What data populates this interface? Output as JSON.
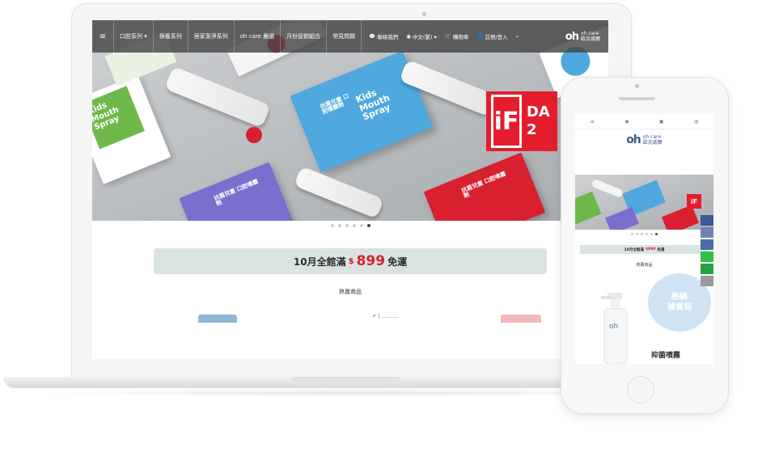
{
  "laptop": {
    "nav": {
      "menu_items": [
        {
          "label": "口腔系列 ▾"
        },
        {
          "label": "保養系列"
        },
        {
          "label": "居家潔淨系列"
        },
        {
          "label": "oh care 嚴選"
        },
        {
          "label": "月份促銷組合"
        },
        {
          "label": "常見問題"
        }
      ],
      "utilities": [
        {
          "icon": "chat-icon",
          "label": "聯絡我們"
        },
        {
          "icon": "globe-icon",
          "label": "中文(繁) ▾"
        },
        {
          "icon": "cart-icon",
          "label": "購物車"
        },
        {
          "icon": "user-icon",
          "label": "註冊/登入"
        },
        {
          "icon": "search-icon",
          "label": ""
        }
      ],
      "logo": {
        "mark": "oh",
        "line1": "oh care",
        "line2": "歐克威爾"
      }
    },
    "hero": {
      "box_texts": {
        "green_box": "Kids Mouth Spray",
        "blue_box": "Kids Mouth Spray",
        "pink_box": "Kids Mouth Spray",
        "purple_box": "抗菌兒童 口腔噴霧劑",
        "red_box": "抗菌兒童 口腔噴霧劑",
        "blue_box_cn": "抗菌兒童 口腔噴霧劑"
      },
      "award": {
        "main": "iF",
        "side": "DA 2"
      },
      "slides_count": 6,
      "active_slide": 6
    },
    "promo": {
      "prefix": "10月全館滿",
      "currency": "$",
      "amount": "899",
      "suffix": "免運"
    },
    "section_title": "熱賣商品",
    "peek_text": "↗ ) ………"
  },
  "phone": {
    "topbar_icons": [
      "menu-icon",
      "globe-icon",
      "cart-icon",
      "user-icon"
    ],
    "logo": {
      "mark": "oh",
      "line1": "oh care",
      "line2": "歐克威爾"
    },
    "promo": {
      "prefix": "10月全館滿",
      "amount": "$899",
      "suffix": "免運"
    },
    "section_title": "熱賣商品",
    "product": {
      "badge_line1": "熱銷",
      "badge_line2": "補貨到",
      "name": "抑菌噴霧"
    },
    "social_icons": [
      "facebook-icon",
      "line-icon",
      "whatsapp-icon",
      "mail-icon"
    ],
    "colors": {
      "accent_red": "#d8202f",
      "promo_bg": "#d9e4e2",
      "brand_blue": "#3d5a8a"
    }
  }
}
